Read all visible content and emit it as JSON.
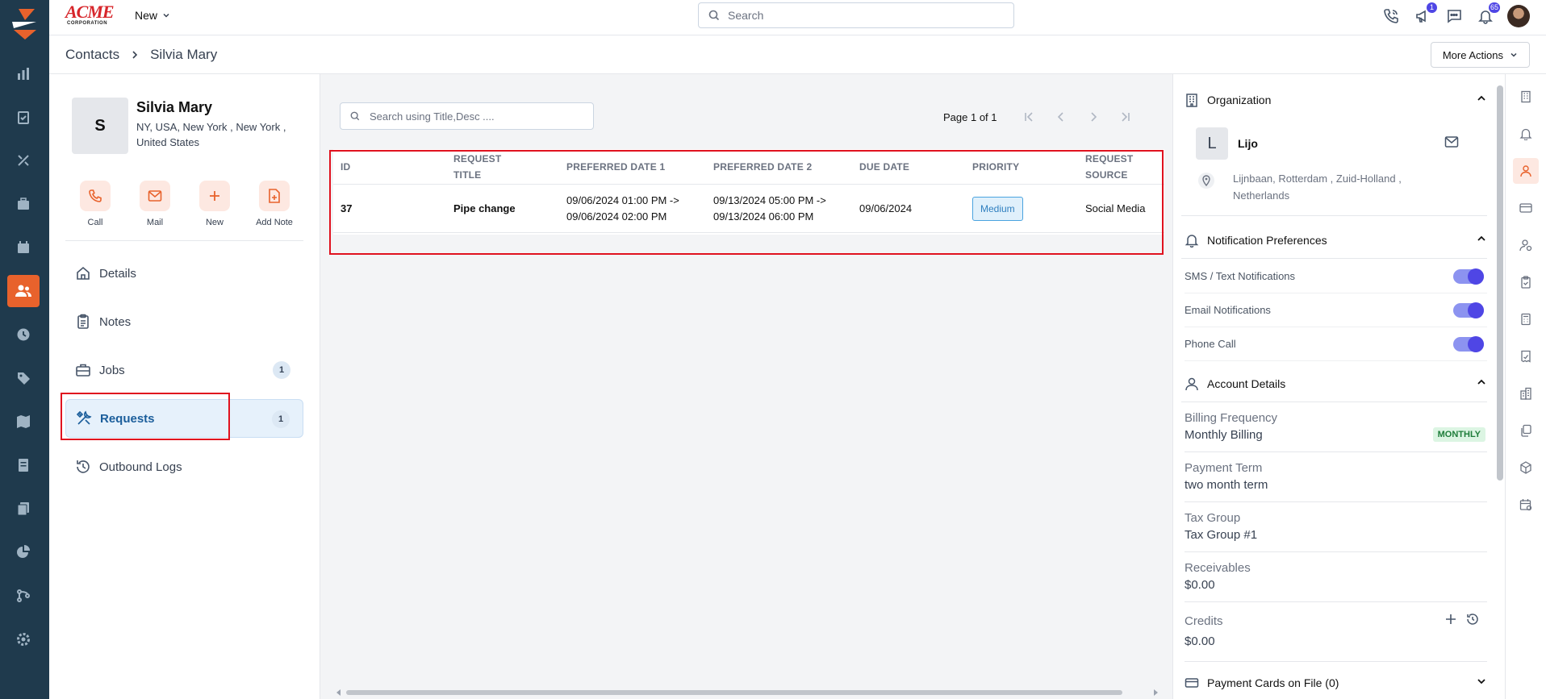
{
  "brand": {
    "logo_text": "ACME",
    "logo_subtext": "CORPORATION"
  },
  "topbar": {
    "new_label": "New",
    "search_placeholder": "Search",
    "badges": {
      "megaphone": "1",
      "bell": "65"
    }
  },
  "breadcrumb": {
    "parent": "Contacts",
    "current": "Silvia Mary"
  },
  "more_actions": "More Actions",
  "contact": {
    "initial": "S",
    "name": "Silvia Mary",
    "address": "NY, USA, New York , New York , United States"
  },
  "actions": [
    {
      "label": "Call",
      "icon": "phone-icon"
    },
    {
      "label": "Mail",
      "icon": "mail-icon"
    },
    {
      "label": "New",
      "icon": "plus-icon"
    },
    {
      "label": "Add Note",
      "icon": "add-note-icon"
    }
  ],
  "nav": [
    {
      "label": "Details",
      "icon": "home-icon"
    },
    {
      "label": "Notes",
      "icon": "clipboard-icon"
    },
    {
      "label": "Jobs",
      "icon": "briefcase-icon",
      "count": "1"
    },
    {
      "label": "Requests",
      "icon": "tools-icon",
      "count": "1",
      "active": true
    },
    {
      "label": "Outbound Logs",
      "icon": "history-icon"
    }
  ],
  "requests": {
    "search_placeholder": "Search using Title,Desc ....",
    "page_info": "Page 1 of 1",
    "columns": {
      "id": "ID",
      "title_line1": "REQUEST",
      "title_line2": "TITLE",
      "date1": "PREFERRED DATE 1",
      "date2": "PREFERRED DATE 2",
      "due": "DUE DATE",
      "priority": "PRIORITY",
      "source_line1": "REQUEST",
      "source_line2": "SOURCE"
    },
    "rows": [
      {
        "id": "37",
        "title": "Pipe change",
        "date1_line1": "09/06/2024 01:00 PM ->",
        "date1_line2": "09/06/2024 02:00 PM",
        "date2_line1": "09/13/2024 05:00 PM ->",
        "date2_line2": "09/13/2024 06:00 PM",
        "due": "09/06/2024",
        "priority": "Medium",
        "source": "Social Media"
      }
    ]
  },
  "organization": {
    "heading": "Organization",
    "initial": "L",
    "name": "Lijo",
    "address": "Lijnbaan, Rotterdam , Zuid-Holland , Netherlands"
  },
  "notifications": {
    "heading": "Notification Preferences",
    "items": [
      {
        "label": "SMS / Text Notifications",
        "enabled": true
      },
      {
        "label": "Email Notifications",
        "enabled": true
      },
      {
        "label": "Phone Call",
        "enabled": true
      }
    ]
  },
  "account": {
    "heading": "Account Details",
    "billing_label": "Billing Frequency",
    "billing_value": "Monthly Billing",
    "billing_badge": "MONTHLY",
    "payment_label": "Payment Term",
    "payment_value": "two month term",
    "tax_label": "Tax Group",
    "tax_value": "Tax Group #1",
    "receivables_label": "Receivables",
    "receivables_value": "$0.00",
    "credits_label": "Credits",
    "credits_value": "$0.00"
  },
  "payment_cards": {
    "heading": "Payment Cards on File (0)"
  },
  "colors": {
    "rail": "#1f3a4d",
    "accent": "#e8622c",
    "toggle": "#4f46e5",
    "highlight": "#e0121f"
  }
}
